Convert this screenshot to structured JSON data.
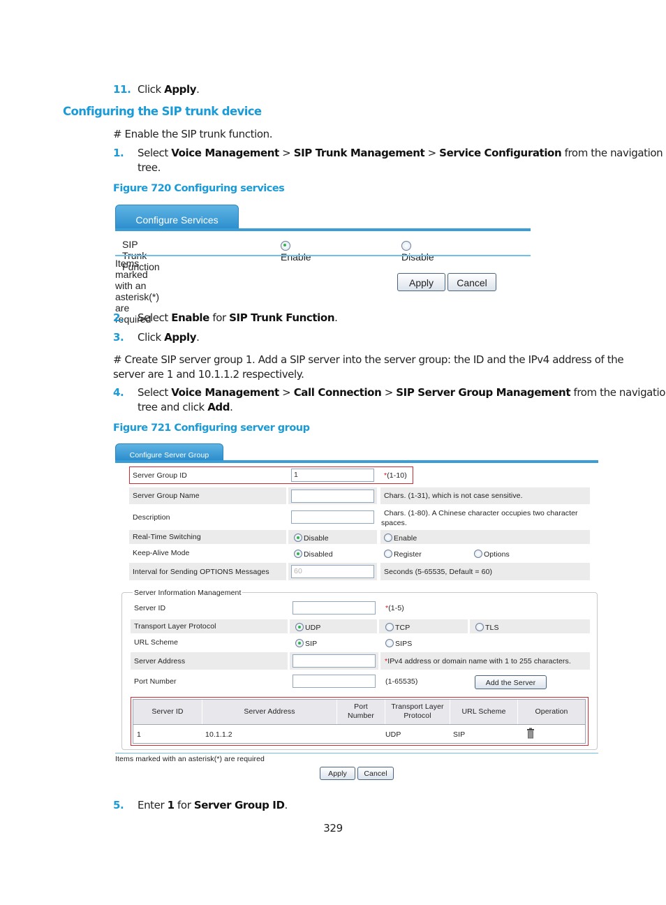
{
  "doc": {
    "step11": {
      "num": "11.",
      "pre": "Click ",
      "bold": "Apply",
      "post": "."
    },
    "section_title": "Configuring the SIP trunk device",
    "comment1": "# Enable the SIP trunk function.",
    "step1": {
      "num": "1.",
      "pre": "Select ",
      "b1": "Voice Management",
      "sep1": " > ",
      "b2": "SIP Trunk Management",
      "sep2": " > ",
      "b3": "Service Configuration",
      "post1": " from the navigation",
      "post2": "tree."
    },
    "figure720": "Figure 720 Configuring services",
    "step2": {
      "num": "2.",
      "pre": "Select ",
      "b1": "Enable",
      "mid": " for ",
      "b2": "SIP Trunk Function",
      "post": "."
    },
    "step3": {
      "num": "3.",
      "pre": "Click ",
      "bold": "Apply",
      "post": "."
    },
    "comment2_line1": "# Create SIP server group 1. Add a SIP server into the server group: the ID and the IPv4 address of the",
    "comment2_line2": "server are 1 and 10.1.1.2 respectively.",
    "step4": {
      "num": "4.",
      "pre": "Select ",
      "b1": "Voice Management",
      "sep1": " > ",
      "b2": "Call Connection",
      "sep2": " > ",
      "b3": "SIP Server Group Management",
      "post1": " from the navigation",
      "post2a": "tree and click ",
      "b4": "Add",
      "post2b": "."
    },
    "figure721": "Figure 721 Configuring server group",
    "step5": {
      "num": "5.",
      "pre": "Enter ",
      "b1": "1",
      "mid": " for ",
      "b2": "Server Group ID",
      "post": "."
    },
    "page_number": "329"
  },
  "fig720": {
    "tab": "Configure Services",
    "field_label": "SIP Trunk Function",
    "options": [
      {
        "label": "Enable",
        "selected": true
      },
      {
        "label": "Disable",
        "selected": false
      }
    ],
    "required_note": "Items marked with an asterisk(*) are required",
    "apply": "Apply",
    "cancel": "Cancel"
  },
  "fig721": {
    "tab": "Configure Server Group",
    "server_group_id": {
      "label": "Server Group ID",
      "value": "1",
      "asterisk": "*",
      "hint": "(1-10)"
    },
    "server_group_name": {
      "label": "Server Group Name",
      "value": "",
      "hint": "Chars. (1-31), which is not case sensitive."
    },
    "description": {
      "label": "Description",
      "value": "",
      "hint": "Chars. (1-80). A Chinese character occupies two character spaces."
    },
    "realtime_switching": {
      "label": "Real-Time Switching",
      "options": [
        {
          "label": "Disable",
          "selected": true
        },
        {
          "label": "Enable",
          "selected": false
        }
      ]
    },
    "keepalive_mode": {
      "label": "Keep-Alive Mode",
      "options": [
        {
          "label": "Disabled",
          "selected": true
        },
        {
          "label": "Register",
          "selected": false
        },
        {
          "label": "Options",
          "selected": false
        }
      ]
    },
    "options_interval": {
      "label": "Interval for Sending OPTIONS Messages",
      "value": "60",
      "hint": "Seconds (5-65535, Default = 60)"
    },
    "server_info": {
      "legend": "Server Information Management",
      "server_id": {
        "label": "Server ID",
        "value": "",
        "asterisk": "*",
        "hint": "(1-5)"
      },
      "transport": {
        "label": "Transport Layer Protocol",
        "options": [
          {
            "label": "UDP",
            "selected": true
          },
          {
            "label": "TCP",
            "selected": false
          },
          {
            "label": "TLS",
            "selected": false
          }
        ]
      },
      "url_scheme": {
        "label": "URL Scheme",
        "options": [
          {
            "label": "SIP",
            "selected": true
          },
          {
            "label": "SIPS",
            "selected": false
          }
        ]
      },
      "server_address": {
        "label": "Server Address",
        "value": "",
        "asterisk": "*",
        "hint": "IPv4 address or domain name with 1 to 255 characters."
      },
      "port_number": {
        "label": "Port Number",
        "value": "",
        "hint": "(1-65535)"
      },
      "add_button": "Add the Server",
      "table": {
        "headers": [
          "Server ID",
          "Server Address",
          "Port Number",
          "Transport Layer Protocol",
          "URL Scheme",
          "Operation"
        ],
        "header_lines": {
          "port": [
            "Port",
            "Number"
          ],
          "transport": [
            "Transport Layer",
            "Protocol"
          ]
        },
        "rows": [
          {
            "server_id": "1",
            "server_address": "10.1.1.2",
            "port": "",
            "transport": "UDP",
            "url_scheme": "SIP",
            "operation_icon": "trash-icon"
          }
        ]
      }
    },
    "required_note": "Items marked with an asterisk(*) are required",
    "apply": "Apply",
    "cancel": "Cancel"
  },
  "colors": {
    "accent": "#1a9bd7",
    "tab_blue": "#2a8ccc",
    "required_red": "#d0161e",
    "highlight_box": "#d22a33"
  }
}
